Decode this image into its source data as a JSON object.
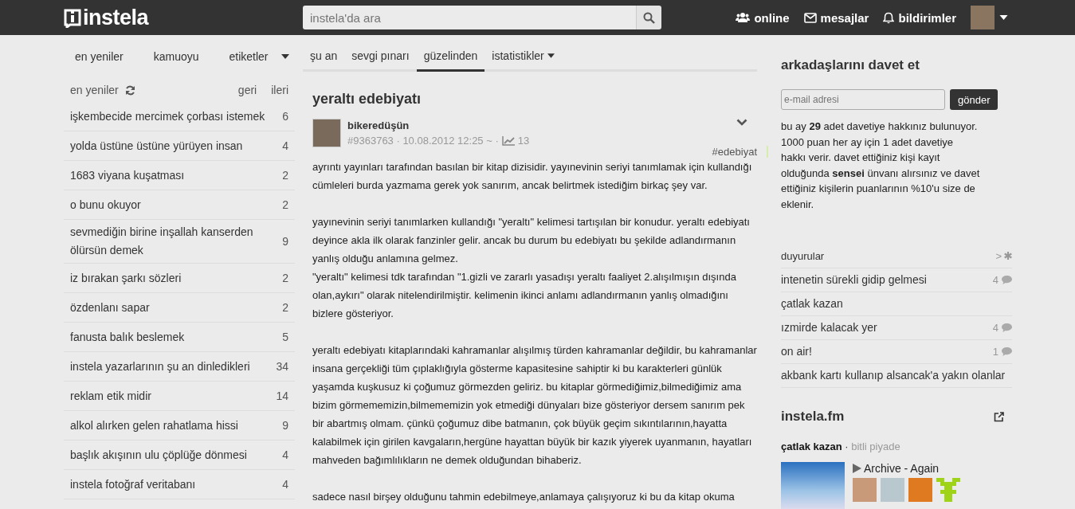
{
  "header": {
    "logo": "instela",
    "search": {
      "placeholder": "instela'da ara"
    },
    "nav": [
      {
        "kind": "users",
        "label": "online"
      },
      {
        "kind": "mail",
        "label": "mesajlar"
      },
      {
        "kind": "bell",
        "label": "bildirimler"
      }
    ]
  },
  "left": {
    "tabs": [
      "en yeniler",
      "kamuoyu",
      "etiketler"
    ],
    "list_title": "en yeniler",
    "pager": [
      "geri",
      "ileri"
    ],
    "topics": [
      {
        "title": "işkembecide mercimek çorbası istemek",
        "count": "6"
      },
      {
        "title": "yolda üstüne üstüne yürüyen insan",
        "count": "4"
      },
      {
        "title": "1683 viyana kuşatması",
        "count": "2"
      },
      {
        "title": "o bunu okuyor",
        "count": "2"
      },
      {
        "title": "sevmediğin birine inşallah kanserden ölürsün demek",
        "count": "9"
      },
      {
        "title": "iz bırakan şarkı sözleri",
        "count": "2"
      },
      {
        "title": "özdenlanı sapar",
        "count": "2"
      },
      {
        "title": "fanusta balık beslemek",
        "count": "5"
      },
      {
        "title": "instela yazarlarının şu an dinledikleri",
        "count": "34"
      },
      {
        "title": "reklam etik midir",
        "count": "14"
      },
      {
        "title": "alkol alırken gelen rahatlama hissi",
        "count": "9"
      },
      {
        "title": "başlık akışının ulu çöplüğe dönmesi",
        "count": "4"
      },
      {
        "title": "instela fotoğraf veritabanı",
        "count": "4"
      }
    ]
  },
  "main": {
    "tabs": [
      {
        "label": "şu an",
        "selected": false
      },
      {
        "label": "sevgi pınarı",
        "selected": false
      },
      {
        "label": "güzelinden",
        "selected": true
      },
      {
        "label": "istatistikler",
        "selected": false
      }
    ],
    "title": "yeraltı edebiyatı",
    "entry": {
      "author": "bikeredüşün",
      "meta": "#9363763 · 10.08.2012 12:25 ~ ·",
      "views": "13",
      "tag": "#edebiyat",
      "paragraphs": [
        "ayrıntı yayınları tarafından basılan bir kitap dizisidir. yayınevinin seriyi tanımlamak için kullandığı cümleleri burda yazmama gerek yok sanırım, ancak belirtmek istediğim birkaç şey var.",
        "yayınevinin seriyi tanımlarken kullandığı \"yeraltı\" kelimesi tartışılan bir konudur. yeraltı edebiyatı deyince akla ilk olarak fanzinler gelir. ancak bu durum bu edebiyatı bu şekilde adlandırmanın yanlış olduğu anlamına gelmez.\n\"yeraltı\" kelimesi tdk tarafından \"1.gizli ve zararlı yasadışı yeraltı faaliyet 2.alışılmışın dışında olan,aykırı\" olarak nitelendirilmiştir. kelimenin ikinci anlamı adlandırmanın yanlış olmadığını bizlere gösteriyor.",
        "yeraltı edebiyatı kitaplarındaki kahramanlar alışılmış türden kahramanlar değildir, bu kahramanlar insana gerçekliği tüm çıplaklığıyla gösterme kapasitesine sahiptir ki bu karakterleri günlük yaşamda kuşkusuz ki çoğumuz görmezden geliriz. bu kitaplar görmediğimiz,bilmediğimiz ama bizim görmememizin,bilmememizin yok etmediği dünyaları bize gösteriyor dersem sanırım pek bir abartmış olmam. çünkü çoğumuz dibe batmanın, çok büyük geçim sıkıntılarının,hayatta kalabilmek için girilen kavgaların,hergüne hayattan büyük bir kazık yiyerek uyanmanın, hayatları mahveden bağımlılıkların ne demek olduğundan bihaberiz.",
        "sadece nasıl birşey olduğunu tahmin edebilmeye,anlamaya çalışıyoruz ki bu da kitap okuma"
      ]
    }
  },
  "right": {
    "invite": {
      "title": "arkadaşlarını davet et",
      "placeholder": "e-mail adresi",
      "button": "gönder",
      "text": "bu ay **29** adet davetiye hakkınız bulunuyor. 1000 puan her ay için 1 adet davetiye hakkı verir. davet ettiğiniz kişi kayıt olduğunda **sensei** ünvanı alırsınız ve davet ettiğiniz kişilerin puanlarının %10'u size de eklenir."
    },
    "announcements": {
      "title": "duyurular",
      "more": ">",
      "items": [
        {
          "title": "intenetin sürekli gidip gelmesi",
          "count": "4"
        },
        {
          "title": "çatlak kazan"
        },
        {
          "title": "ızmirde kalacak yer",
          "count": "4"
        },
        {
          "title": "on air!",
          "count": "1"
        },
        {
          "title": "akbank kartı kullanıp alsancak'a yakın olanlar"
        }
      ]
    },
    "fm": {
      "title": "instela.fm",
      "user": "çatlak kazan",
      "separator": "·",
      "listener": "bitli piyade",
      "track": "Archive - Again"
    }
  }
}
